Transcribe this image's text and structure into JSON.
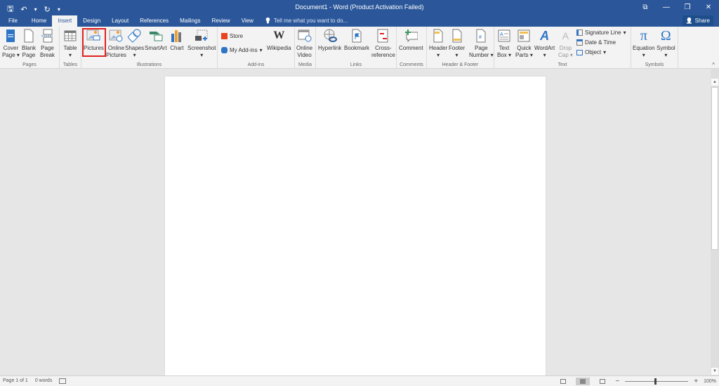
{
  "window": {
    "title": "Document1 - Word (Product Activation Failed)",
    "controls": {
      "ribbon_display": "⧉",
      "minimize": "—",
      "restore": "❐",
      "close": "✕"
    }
  },
  "qat": {
    "save": "🖫",
    "undo": "↶",
    "undo_dd": "▾",
    "redo": "↻",
    "customize": "▾"
  },
  "tabs": [
    {
      "label": "File"
    },
    {
      "label": "Home"
    },
    {
      "label": "Insert"
    },
    {
      "label": "Design"
    },
    {
      "label": "Layout"
    },
    {
      "label": "References"
    },
    {
      "label": "Mailings"
    },
    {
      "label": "Review"
    },
    {
      "label": "View"
    }
  ],
  "tell_me": {
    "icon": "💡",
    "placeholder": "Tell me what you want to do..."
  },
  "share": {
    "label": "Share",
    "icon": "👤"
  },
  "ribbon": {
    "pages": {
      "label": "Pages",
      "buttons": [
        {
          "line1": "Cover",
          "line2": "Page ▾"
        },
        {
          "line1": "Blank",
          "line2": "Page"
        },
        {
          "line1": "Page",
          "line2": "Break"
        }
      ]
    },
    "tables": {
      "label": "Tables",
      "buttons": [
        {
          "line1": "Table",
          "line2": "▾"
        }
      ]
    },
    "illustrations": {
      "label": "Illustrations",
      "buttons": [
        {
          "line1": "Pictures",
          "line2": ""
        },
        {
          "line1": "Online",
          "line2": "Pictures"
        },
        {
          "line1": "Shapes",
          "line2": "▾"
        },
        {
          "line1": "SmartArt",
          "line2": ""
        },
        {
          "line1": "Chart",
          "line2": ""
        },
        {
          "line1": "Screenshot",
          "line2": "▾"
        }
      ]
    },
    "addins": {
      "label": "Add-ins",
      "store": "Store",
      "my_addins": "My Add-ins",
      "my_addins_dd": "▾",
      "wikipedia": "Wikipedia",
      "wiki_icon": "W"
    },
    "media": {
      "label": "Media",
      "buttons": [
        {
          "line1": "Online",
          "line2": "Video"
        }
      ]
    },
    "links": {
      "label": "Links",
      "buttons": [
        {
          "line1": "Hyperlink",
          "line2": ""
        },
        {
          "line1": "Bookmark",
          "line2": ""
        },
        {
          "line1": "Cross-",
          "line2": "reference"
        }
      ]
    },
    "comments": {
      "label": "Comments",
      "buttons": [
        {
          "line1": "Comment",
          "line2": ""
        }
      ]
    },
    "header_footer": {
      "label": "Header & Footer",
      "buttons": [
        {
          "line1": "Header",
          "line2": "▾"
        },
        {
          "line1": "Footer",
          "line2": "▾"
        },
        {
          "line1": "Page",
          "line2": "Number ▾"
        }
      ]
    },
    "text": {
      "label": "Text",
      "buttons": [
        {
          "line1": "Text",
          "line2": "Box ▾"
        },
        {
          "line1": "Quick",
          "line2": "Parts ▾"
        },
        {
          "line1": "WordArt",
          "line2": "▾"
        },
        {
          "line1": "Drop",
          "line2": "Cap ▾"
        }
      ],
      "small": [
        {
          "label": "Signature Line",
          "dd": "▾"
        },
        {
          "label": "Date & Time",
          "dd": ""
        },
        {
          "label": "Object",
          "dd": "▾"
        }
      ]
    },
    "symbols": {
      "label": "Symbols",
      "buttons": [
        {
          "line1": "Equation",
          "line2": "▾",
          "glyph": "π"
        },
        {
          "line1": "Symbol",
          "line2": "▾",
          "glyph": "Ω"
        }
      ]
    },
    "collapse": "^"
  },
  "status": {
    "page": "Page 1 of 1",
    "words": "0 words",
    "zoom": "100%",
    "zoom_minus": "−",
    "zoom_plus": "+",
    "zoom_level_percent": 100
  },
  "scroll": {
    "up": "▲",
    "down": "▼"
  },
  "colors": {
    "brand": "#2b579a",
    "highlight": "#e0201f"
  }
}
